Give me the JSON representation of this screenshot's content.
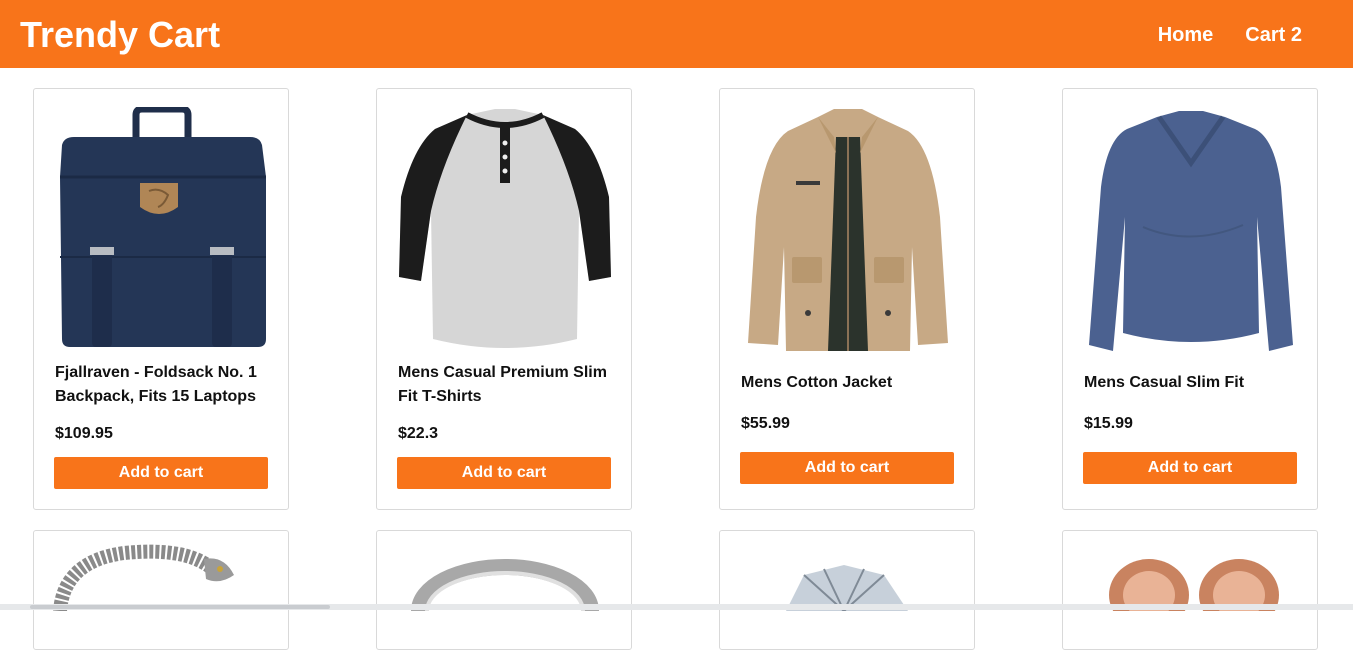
{
  "header": {
    "brand": "Trendy Cart",
    "nav": [
      {
        "label": "Home"
      },
      {
        "label": "Cart 2"
      }
    ],
    "accent_color": "#f8741a"
  },
  "products": [
    {
      "title": "Fjallraven - Foldsack No. 1 Backpack, Fits 15 Laptops",
      "price": "$109.95",
      "button": "Add to cart",
      "icon": "backpack-image"
    },
    {
      "title": "Mens Casual Premium Slim Fit T-Shirts",
      "price": "$22.3",
      "button": "Add to cart",
      "icon": "tshirt-image"
    },
    {
      "title": "Mens Cotton Jacket",
      "price": "$55.99",
      "button": "Add to cart",
      "icon": "jacket-image"
    },
    {
      "title": "Mens Casual Slim Fit",
      "price": "$15.99",
      "button": "Add to cart",
      "icon": "longsleeve-image"
    }
  ],
  "products_row2": [
    {
      "icon": "bracelet-image"
    },
    {
      "icon": "ring-image"
    },
    {
      "icon": "diamond-ring-image"
    },
    {
      "icon": "earrings-image"
    }
  ]
}
